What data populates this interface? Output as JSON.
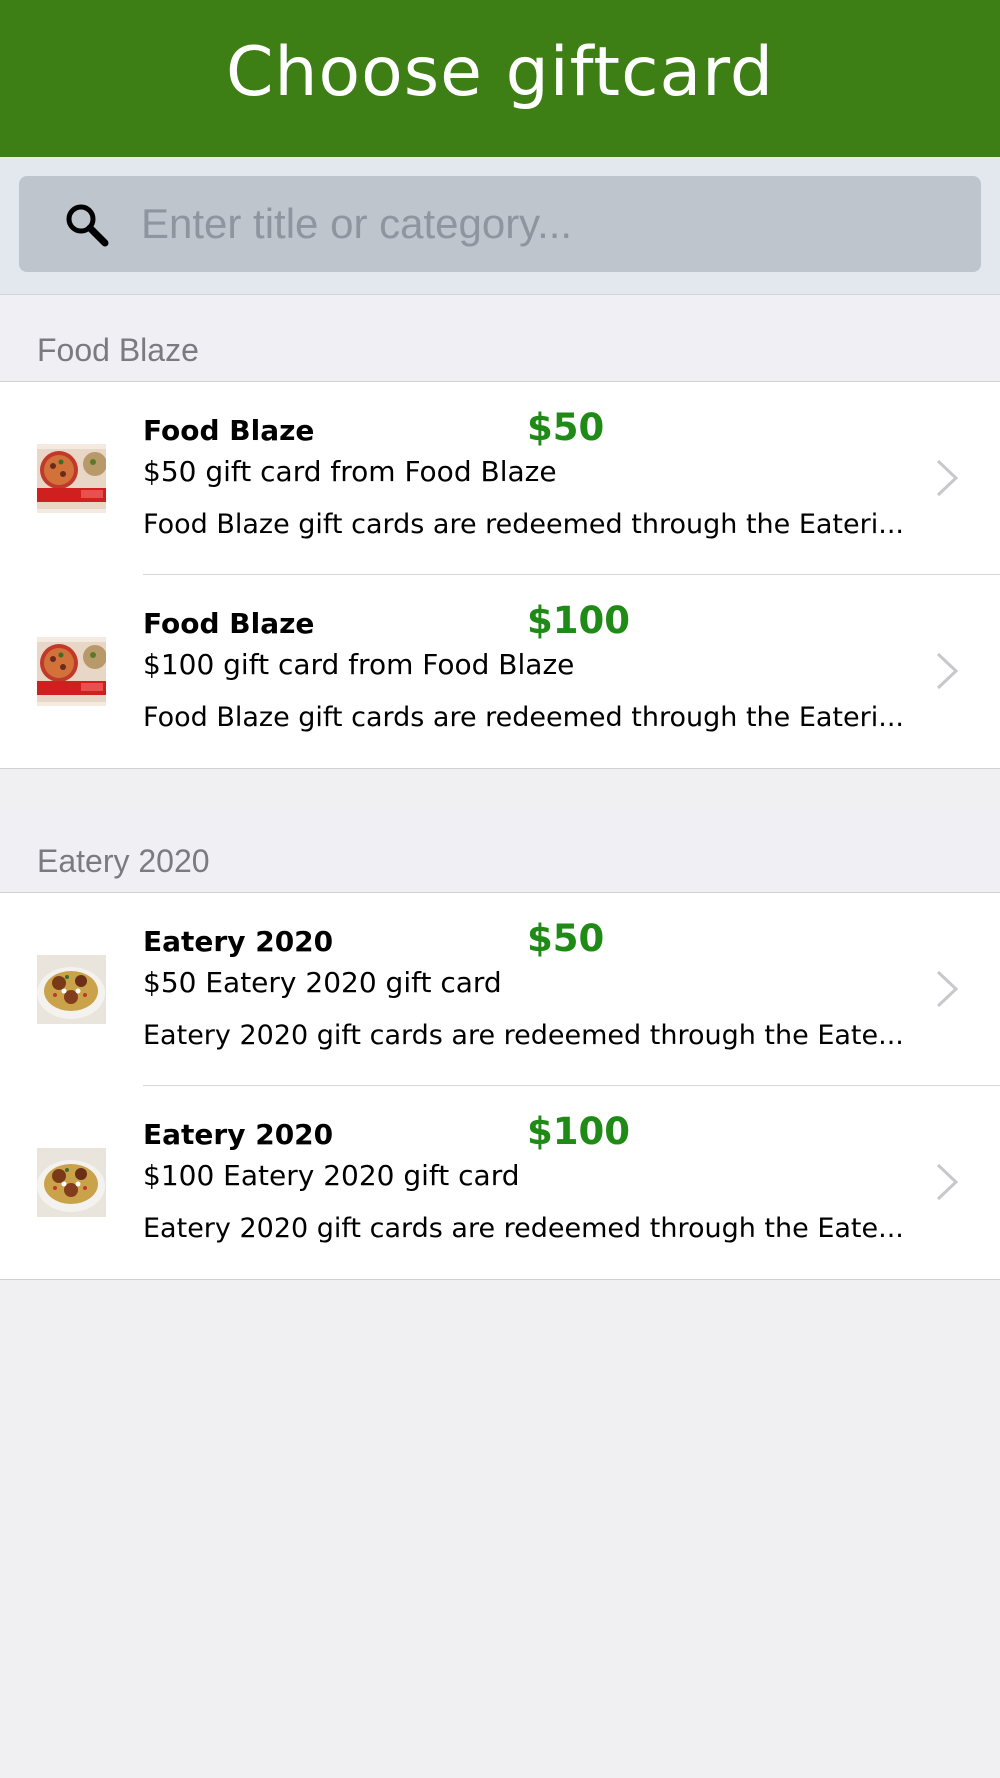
{
  "header": {
    "title": "Choose giftcard"
  },
  "search": {
    "placeholder": "Enter title or category...",
    "value": ""
  },
  "colors": {
    "header_bg": "#3d7f14",
    "price": "#1f8a16"
  },
  "sections": [
    {
      "label": "Food Blaze",
      "items": [
        {
          "title": "Food Blaze",
          "price": "$50",
          "subtitle": "$50 gift card from Food Blaze",
          "description": "Food Blaze gift cards are redeemed through the Eateri...",
          "thumb_icon": "pizza-thumbnail"
        },
        {
          "title": "Food Blaze",
          "price": "$100",
          "subtitle": "$100 gift card from Food Blaze",
          "description": "Food Blaze gift cards are redeemed through the Eateri...",
          "thumb_icon": "pizza-thumbnail"
        }
      ]
    },
    {
      "label": "Eatery 2020",
      "items": [
        {
          "title": "Eatery 2020",
          "price": "$50",
          "subtitle": "$50 Eatery 2020 gift card",
          "description": "Eatery 2020 gift cards are redeemed through the Eate...",
          "thumb_icon": "dish-thumbnail"
        },
        {
          "title": "Eatery 2020",
          "price": "$100",
          "subtitle": "$100 Eatery 2020 gift card",
          "description": "Eatery 2020 gift cards are redeemed through the Eate...",
          "thumb_icon": "dish-thumbnail"
        }
      ]
    }
  ]
}
